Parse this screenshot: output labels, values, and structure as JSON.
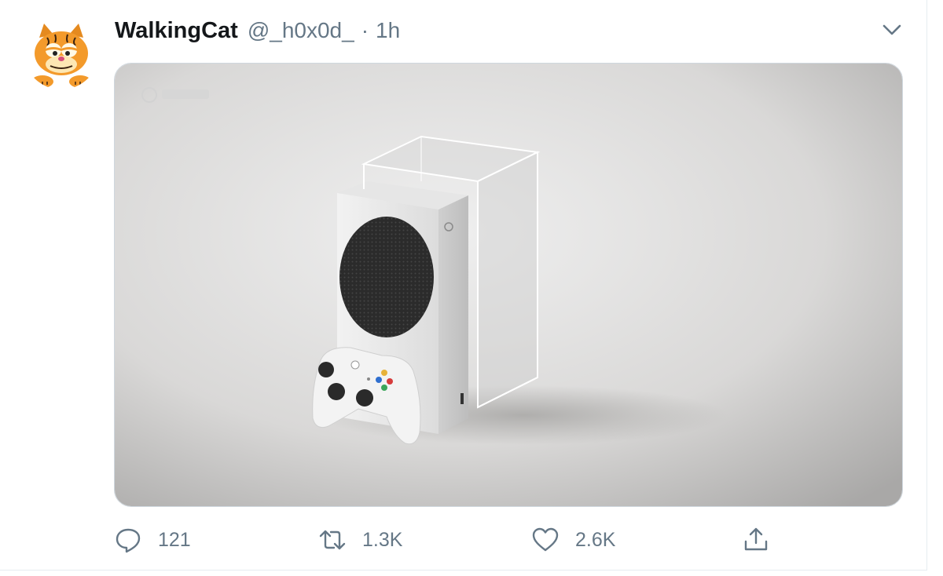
{
  "tweet": {
    "author": {
      "name": "WalkingCat",
      "handle": "@_h0x0d_",
      "separator": "·",
      "time": "1h",
      "avatar": "garfield-avatar"
    },
    "menu_icon": "chevron-down-icon",
    "media": {
      "subject": "console-and-controller-photo"
    },
    "actions": {
      "reply": {
        "icon": "reply-icon",
        "count": "121"
      },
      "retweet": {
        "icon": "retweet-icon",
        "count": "1.3K"
      },
      "like": {
        "icon": "heart-icon",
        "count": "2.6K"
      },
      "share": {
        "icon": "share-icon"
      }
    }
  },
  "colors": {
    "text": "#14171a",
    "secondary": "#657786",
    "border": "#e6ecf0"
  }
}
